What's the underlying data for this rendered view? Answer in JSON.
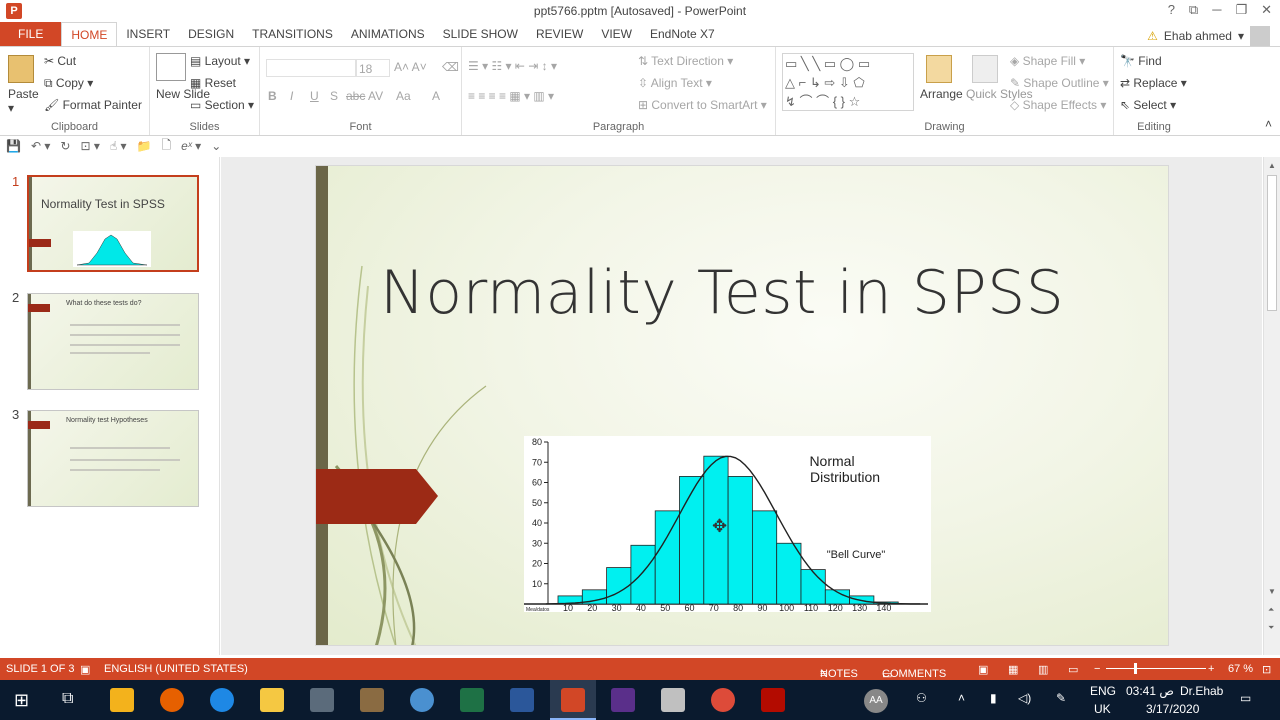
{
  "window": {
    "title": "ppt5766.pptm [Autosaved] - PowerPoint",
    "app_icon": "P",
    "controls": [
      "?",
      "⧉",
      "─",
      "❐",
      "✕"
    ]
  },
  "tabs": [
    "FILE",
    "HOME",
    "INSERT",
    "DESIGN",
    "TRANSITIONS",
    "ANIMATIONS",
    "SLIDE SHOW",
    "REVIEW",
    "VIEW",
    "EndNote X7"
  ],
  "active_tab": "HOME",
  "user": {
    "name": "Ehab ahmed"
  },
  "ribbon": {
    "clipboard": {
      "label": "Clipboard",
      "paste": "Paste",
      "cut": "Cut",
      "copy": "Copy",
      "format_painter": "Format Painter"
    },
    "slides": {
      "label": "Slides",
      "new_slide": "New Slide",
      "layout": "Layout",
      "reset": "Reset",
      "section": "Section"
    },
    "font": {
      "label": "Font",
      "size": "18",
      "styles": [
        "B",
        "I",
        "U",
        "S",
        "abc",
        "AV",
        "Aa",
        "A"
      ]
    },
    "paragraph": {
      "label": "Paragraph",
      "text_direction": "Text Direction",
      "align_text": "Align Text",
      "convert_smartart": "Convert to SmartArt"
    },
    "drawing": {
      "label": "Drawing",
      "arrange": "Arrange",
      "quick_styles": "Quick Styles",
      "shape_fill": "Shape Fill",
      "shape_outline": "Shape Outline",
      "shape_effects": "Shape Effects"
    },
    "editing": {
      "label": "Editing",
      "find": "Find",
      "replace": "Replace",
      "select": "Select"
    }
  },
  "thumbnails": [
    {
      "num": "1",
      "title": "Normality Test in SPSS"
    },
    {
      "num": "2",
      "title": "What do these tests do?"
    },
    {
      "num": "3",
      "title": "Normality test Hypotheses"
    }
  ],
  "slide": {
    "title": "Normality Test in SPSS"
  },
  "chart_data": {
    "type": "bar",
    "title": "Normal Distribution",
    "annotation": "\"Bell Curve\"",
    "categories": [
      "10",
      "20",
      "30",
      "40",
      "50",
      "60",
      "70",
      "80",
      "90",
      "100",
      "110",
      "120",
      "130",
      "140"
    ],
    "values": [
      4,
      7,
      18,
      29,
      46,
      63,
      73,
      63,
      46,
      30,
      17,
      7,
      4,
      1
    ],
    "ylim": [
      0,
      80
    ],
    "yticks": [
      10,
      20,
      30,
      40,
      50,
      60,
      70,
      80
    ],
    "xlabel": "",
    "x_first_label": "Mea/datos",
    "bar_color": "#00f0f0"
  },
  "status": {
    "slide": "SLIDE 1 OF 3",
    "language": "ENGLISH (UNITED STATES)",
    "notes": "NOTES",
    "comments": "COMMENTS",
    "zoom": "67 %"
  },
  "taskbar": {
    "lang": "ENG",
    "lang2": "UK",
    "time": "03:41 ص",
    "date": "3/17/2020",
    "user": "Dr.Ehab",
    "avatar": "AA"
  }
}
